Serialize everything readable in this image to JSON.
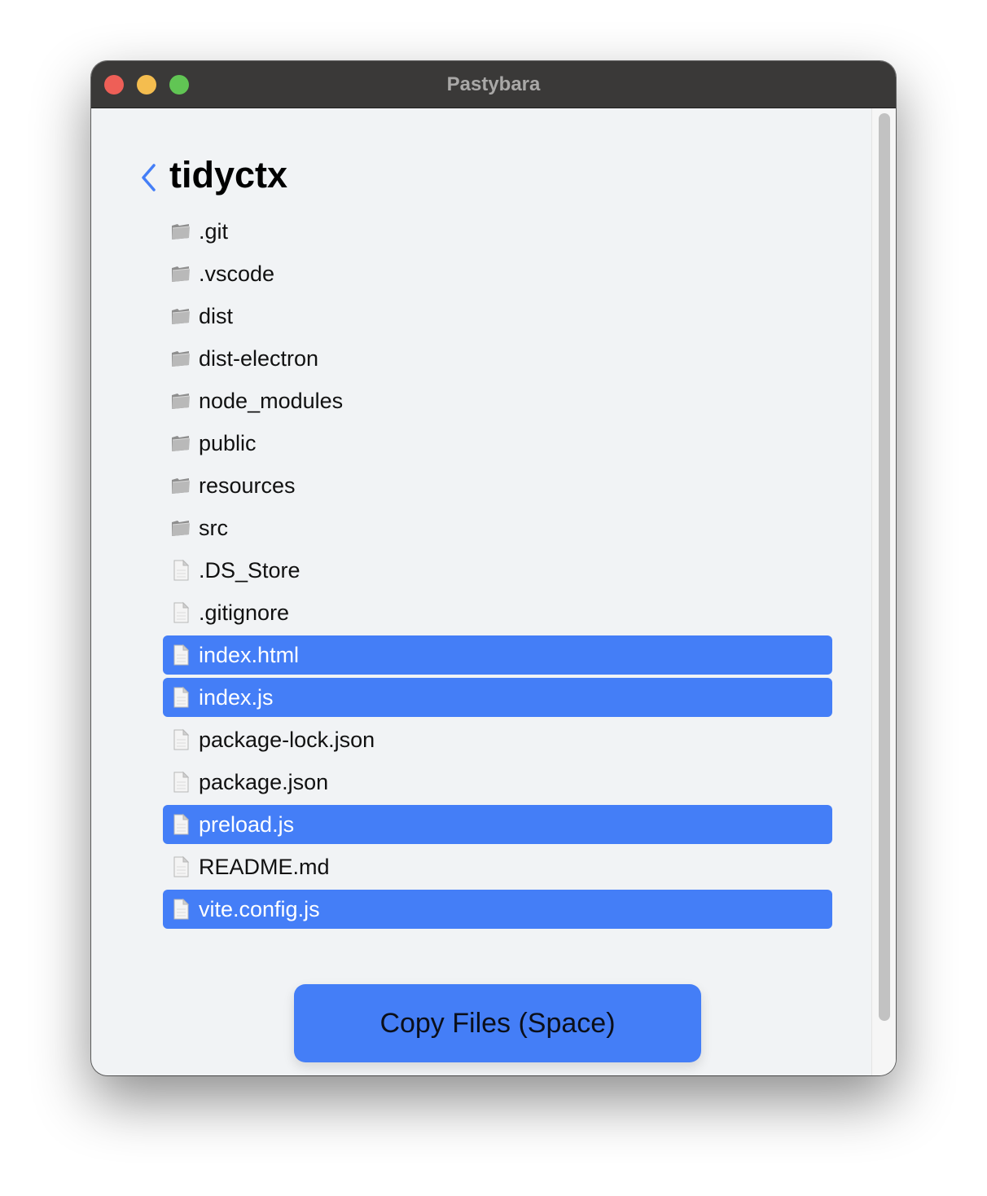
{
  "window": {
    "title": "Pastybara"
  },
  "header": {
    "back_icon": "chevron-left-icon",
    "title": "tidyctx"
  },
  "colors": {
    "accent": "#447ef7",
    "background": "#f1f3f5",
    "titlebar": "#3a3938"
  },
  "files": [
    {
      "name": ".git",
      "type": "folder",
      "selected": false
    },
    {
      "name": ".vscode",
      "type": "folder",
      "selected": false
    },
    {
      "name": "dist",
      "type": "folder",
      "selected": false
    },
    {
      "name": "dist-electron",
      "type": "folder",
      "selected": false
    },
    {
      "name": "node_modules",
      "type": "folder",
      "selected": false
    },
    {
      "name": "public",
      "type": "folder",
      "selected": false
    },
    {
      "name": "resources",
      "type": "folder",
      "selected": false
    },
    {
      "name": "src",
      "type": "folder",
      "selected": false
    },
    {
      "name": ".DS_Store",
      "type": "file",
      "selected": false
    },
    {
      "name": ".gitignore",
      "type": "file",
      "selected": false
    },
    {
      "name": "index.html",
      "type": "file",
      "selected": true
    },
    {
      "name": "index.js",
      "type": "file",
      "selected": true
    },
    {
      "name": "package-lock.json",
      "type": "file",
      "selected": false
    },
    {
      "name": "package.json",
      "type": "file",
      "selected": false
    },
    {
      "name": "preload.js",
      "type": "file",
      "selected": true
    },
    {
      "name": "README.md",
      "type": "file",
      "selected": false
    },
    {
      "name": "vite.config.js",
      "type": "file",
      "selected": true
    }
  ],
  "actions": {
    "copy_label": "Copy Files (Space)"
  }
}
